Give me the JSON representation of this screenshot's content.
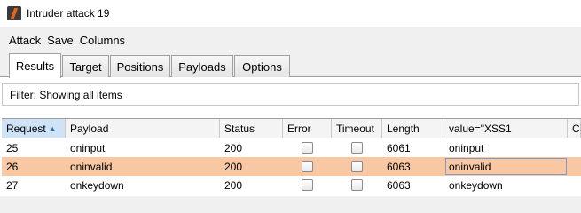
{
  "window": {
    "title": "Intruder attack 19",
    "icon": "burp-icon"
  },
  "menu": [
    "Attack",
    "Save",
    "Columns"
  ],
  "tabs": [
    "Results",
    "Target",
    "Positions",
    "Payloads",
    "Options"
  ],
  "active_tab": "Results",
  "filter": {
    "text": "Filter: Showing all items"
  },
  "table": {
    "columns": [
      "Request",
      "Payload",
      "Status",
      "Error",
      "Timeout",
      "Length",
      "value=\"XSS1",
      "C"
    ],
    "sort_column": "Request",
    "sort_direction": "ascending",
    "rows": [
      {
        "request": "25",
        "payload": "oninput",
        "status": "200",
        "error": false,
        "timeout": false,
        "length": "6061",
        "value": "oninput"
      },
      {
        "request": "26",
        "payload": "oninvalid",
        "status": "200",
        "error": false,
        "timeout": false,
        "length": "6063",
        "value": "oninvalid"
      },
      {
        "request": "27",
        "payload": "onkeydown",
        "status": "200",
        "error": false,
        "timeout": false,
        "length": "6063",
        "value": "onkeydown"
      }
    ],
    "selected_row": "26",
    "selection_color": "#f9c8a2"
  }
}
